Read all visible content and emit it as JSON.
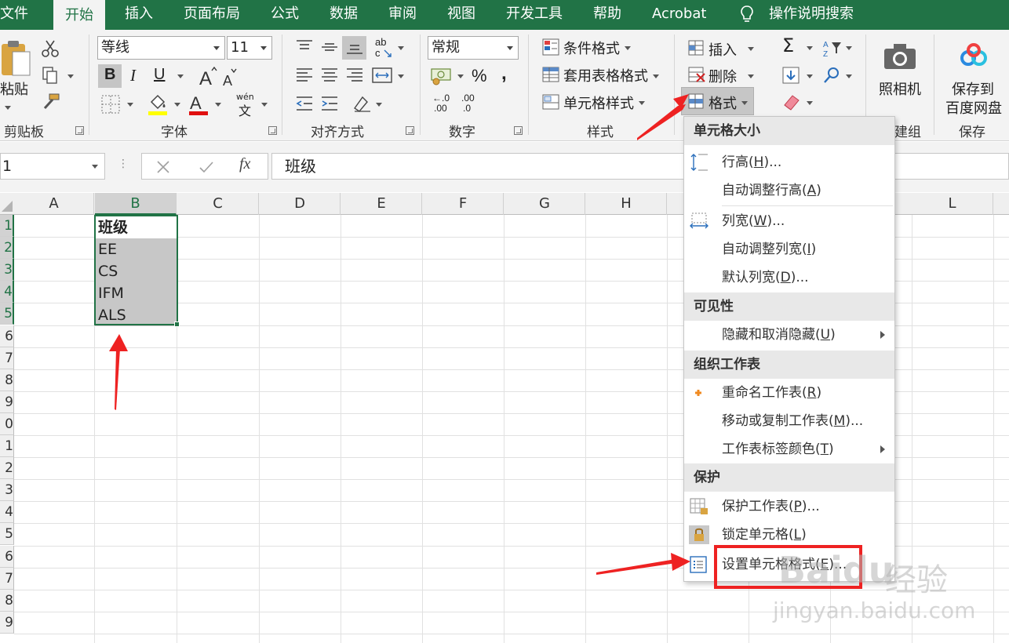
{
  "ribbon_tabs": [
    "文件",
    "开始",
    "插入",
    "页面布局",
    "公式",
    "数据",
    "审阅",
    "视图",
    "开发工具",
    "帮助",
    "Acrobat"
  ],
  "tell_me": "操作说明搜索",
  "clipboard": {
    "paste": "粘贴",
    "group": "剪贴板"
  },
  "font": {
    "name": "等线",
    "size": "11",
    "group": "字体",
    "phonetic": "wén",
    "phonetic_char": "文",
    "bold": "B",
    "italic": "I",
    "underline": "U"
  },
  "alignment": {
    "group": "对齐方式",
    "orient_top": "ab",
    "orient_bottom": "c"
  },
  "number": {
    "format": "常规",
    "group": "数字",
    "percent": "%",
    "comma": ",",
    "inc_dec": ".00",
    "inc_dec_top": "←.0",
    "dec_dec": ".0",
    "dec_dec_top": ".00"
  },
  "styles": {
    "conditional": "条件格式",
    "table": "套用表格格式",
    "cell": "单元格样式",
    "group": "样式"
  },
  "cells": {
    "insert": "插入",
    "delete": "删除",
    "format": "格式",
    "group_partial": "建组"
  },
  "camera": {
    "label": "照相机"
  },
  "save": {
    "label_line1": "保存到",
    "label_line2": "百度网盘",
    "group": "保存"
  },
  "formula_bar": {
    "name_box": "1",
    "content": "班级",
    "fx": "fx"
  },
  "columns": [
    "A",
    "B",
    "C",
    "D",
    "E",
    "F",
    "G",
    "H",
    "L"
  ],
  "row_headers": [
    "1",
    "2",
    "3",
    "4",
    "5",
    "6",
    "7",
    "8",
    "9",
    "0",
    "1",
    "2",
    "3",
    "4",
    "5",
    "6",
    "7",
    "8",
    "9"
  ],
  "cells_data": [
    "班级",
    "EE",
    "CS",
    "IFM",
    "ALS"
  ],
  "menu": {
    "sections": [
      "单元格大小",
      "可见性",
      "组织工作表",
      "保护"
    ],
    "row_height": {
      "text": "行高(",
      "key": "H",
      "suffix": ")..."
    },
    "autofit_row": {
      "text": "自动调整行高(",
      "key": "A",
      "suffix": ")"
    },
    "col_width": {
      "text": "列宽(",
      "key": "W",
      "suffix": ")..."
    },
    "autofit_col": {
      "text": "自动调整列宽(",
      "key": "I",
      "suffix": ")"
    },
    "default_width": {
      "text": "默认列宽(",
      "key": "D",
      "suffix": ")..."
    },
    "hide_unhide": {
      "text": "隐藏和取消隐藏(",
      "key": "U",
      "suffix": ")"
    },
    "rename": {
      "text": "重命名工作表(",
      "key": "R",
      "suffix": ")"
    },
    "move_copy": {
      "text": "移动或复制工作表(",
      "key": "M",
      "suffix": ")..."
    },
    "tab_color": {
      "text": "工作表标签颜色(",
      "key": "T",
      "suffix": ")"
    },
    "protect": {
      "text": "保护工作表(",
      "key": "P",
      "suffix": ")..."
    },
    "lock": {
      "text": "锁定单元格(",
      "key": "L",
      "suffix": ")"
    },
    "format_cells": {
      "text": "设置单元格格式(",
      "key": "E",
      "suffix": ")..."
    }
  },
  "watermark": {
    "logo": "Baidu",
    "logo2": "经验",
    "url": "jingyan.baidu.com"
  },
  "colors": {
    "excel_green": "#217346",
    "ribbon_bg": "#f3f3f3",
    "annotation_red": "#ee2222",
    "selection_gray": "#c7c7c7"
  }
}
